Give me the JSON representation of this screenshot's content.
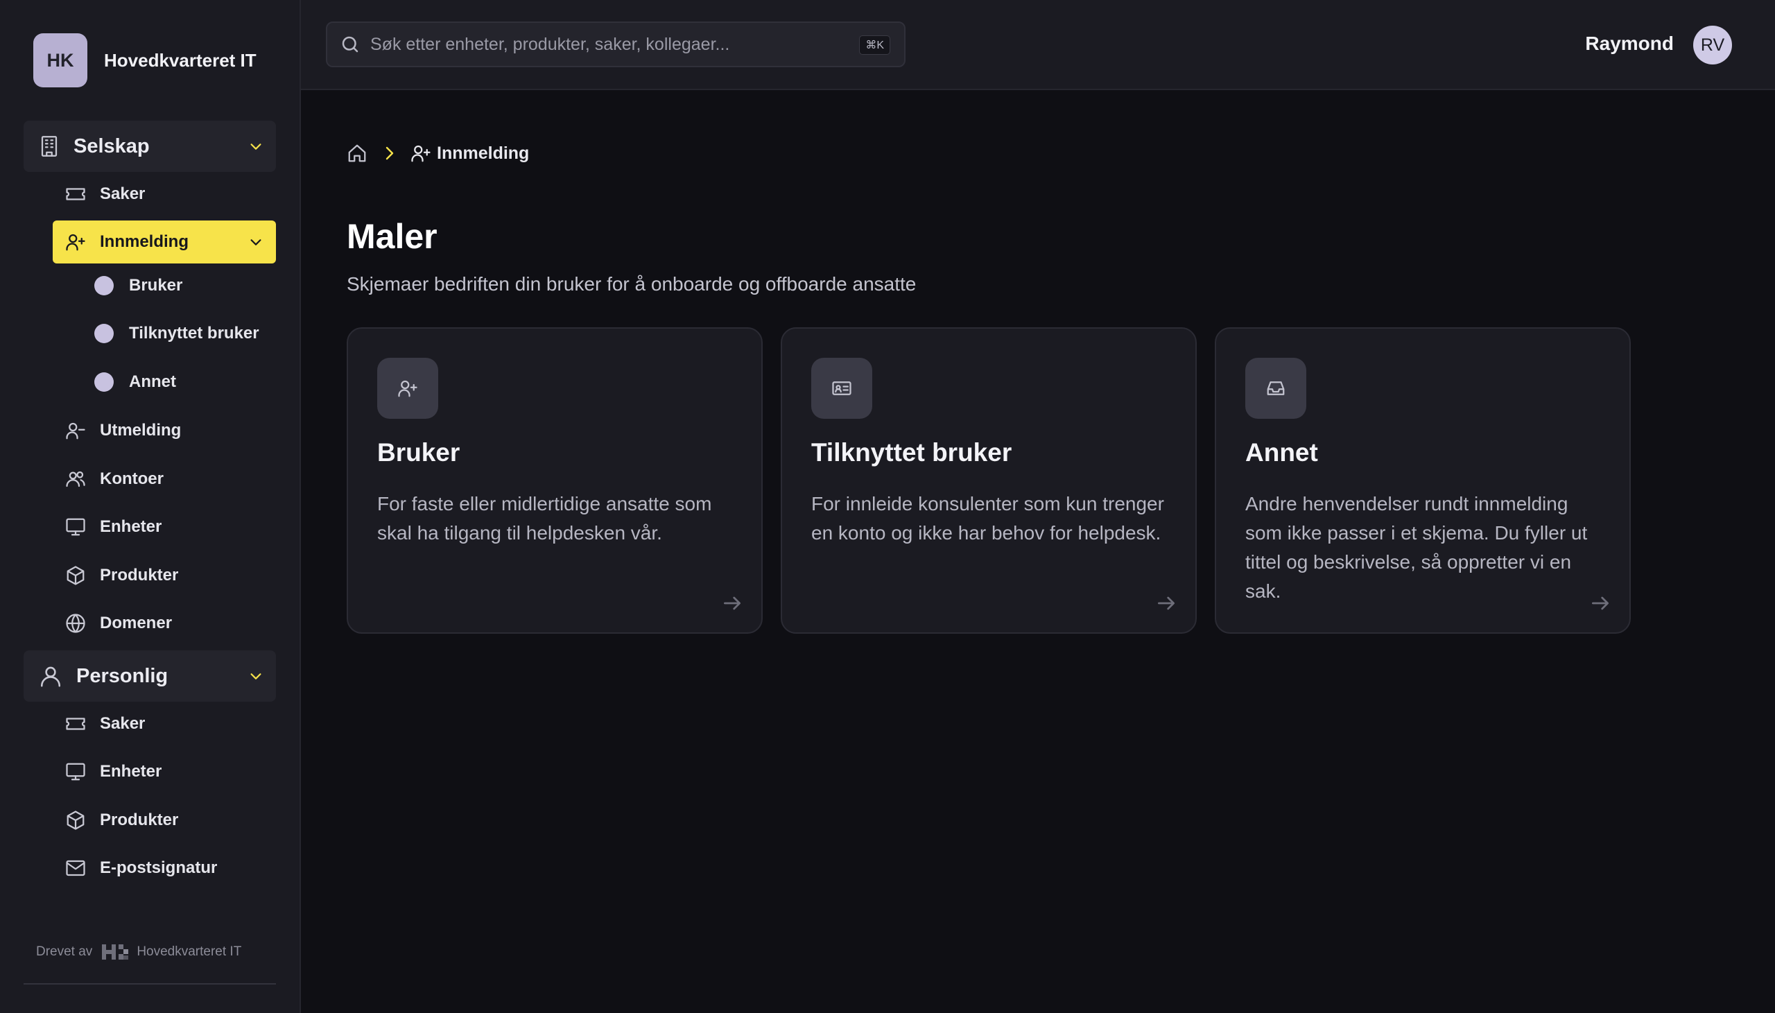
{
  "brand": {
    "initials": "HK",
    "name": "Hovedkvarteret IT"
  },
  "sidebar": {
    "company_section": {
      "label": "Selskap",
      "items": [
        {
          "label": "Saker",
          "icon": "ticket-icon"
        },
        {
          "label": "Innmelding",
          "icon": "user-plus-icon",
          "active": true,
          "children": [
            {
              "label": "Bruker"
            },
            {
              "label": "Tilknyttet bruker"
            },
            {
              "label": "Annet"
            }
          ]
        },
        {
          "label": "Utmelding",
          "icon": "user-minus-icon"
        },
        {
          "label": "Kontoer",
          "icon": "users-icon"
        },
        {
          "label": "Enheter",
          "icon": "monitor-icon"
        },
        {
          "label": "Produkter",
          "icon": "package-icon"
        },
        {
          "label": "Domener",
          "icon": "globe-icon"
        }
      ]
    },
    "personal_section": {
      "label": "Personlig",
      "items": [
        {
          "label": "Saker",
          "icon": "ticket-icon"
        },
        {
          "label": "Enheter",
          "icon": "monitor-icon"
        },
        {
          "label": "Produkter",
          "icon": "package-icon"
        },
        {
          "label": "E-postsignatur",
          "icon": "mail-icon"
        }
      ]
    },
    "footer": {
      "prefix": "Drevet av",
      "name": "Hovedkvarteret IT"
    }
  },
  "topbar": {
    "search_placeholder": "Søk etter enheter, produkter, saker, kollegaer...",
    "shortcut": "⌘K",
    "user_name": "Raymond",
    "user_initials": "RV"
  },
  "breadcrumb": {
    "current": "Innmelding"
  },
  "main": {
    "title": "Maler",
    "subtitle": "Skjemaer bedriften din bruker for å onboarde og offboarde ansatte",
    "cards": [
      {
        "title": "Bruker",
        "icon": "user-plus-icon",
        "description": "For faste eller midlertidige ansatte som skal ha tilgang til helpdesken vår."
      },
      {
        "title": "Tilknyttet bruker",
        "icon": "id-card-icon",
        "description": "For innleide konsulenter som kun trenger en konto og ikke har behov for helpdesk."
      },
      {
        "title": "Annet",
        "icon": "inbox-icon",
        "description": "Andre henvendelser rundt innmelding som ikke passer i et skjema. Du fyller ut tittel og beskrivelse, så oppretter vi en sak."
      }
    ]
  },
  "colors": {
    "accent": "#f7e34a",
    "background": "#0f0f14",
    "panel": "#1b1b22"
  }
}
